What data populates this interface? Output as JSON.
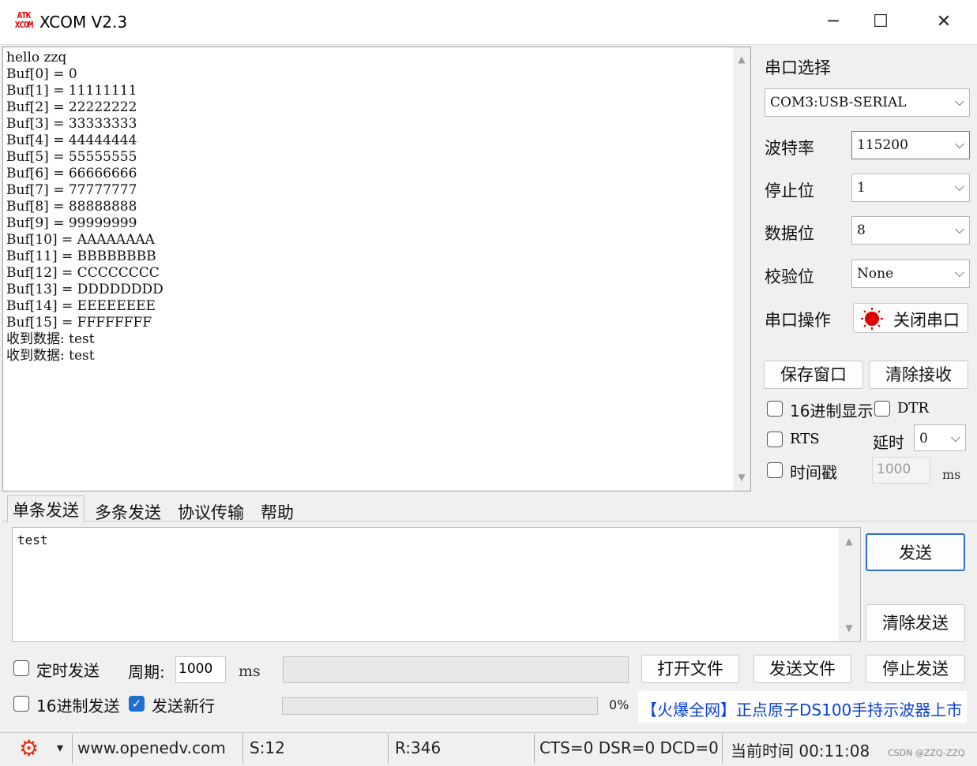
{
  "titlebar": {
    "logo_top": "ATK",
    "logo_bottom": "XCOM",
    "title": "XCOM V2.3",
    "minimize_icon": "─",
    "maximize_icon": "☐",
    "close_icon": "✕"
  },
  "receive": {
    "text": "hello zzq\nBuf[0] = 0\nBuf[1] = 11111111\nBuf[2] = 22222222\nBuf[3] = 33333333\nBuf[4] = 44444444\nBuf[5] = 55555555\nBuf[6] = 66666666\nBuf[7] = 77777777\nBuf[8] = 88888888\nBuf[9] = 99999999\nBuf[10] = AAAAAAAA\nBuf[11] = BBBBBBBB\nBuf[12] = CCCCCCCC\nBuf[13] = DDDDDDDD\nBuf[14] = EEEEEEEE\nBuf[15] = FFFFFFFF\n收到数据: test\n收到数据: test"
  },
  "serial": {
    "port_label": "串口选择",
    "port_value": "COM3:USB-SERIAL",
    "baud_label": "波特率",
    "baud_value": "115200",
    "stop_label": "停止位",
    "stop_value": "1",
    "data_label": "数据位",
    "data_value": "8",
    "parity_label": "校验位",
    "parity_value": "None",
    "op_label": "串口操作",
    "close_port_button": "关闭串口",
    "status_color": "#e00000"
  },
  "actions": {
    "save_window": "保存窗口",
    "clear_receive": "清除接收",
    "hex_display": "16进制显示",
    "dtr": "DTR",
    "rts": "RTS",
    "delay_label": "延时",
    "delay_value": "0",
    "timestamp": "时间戳",
    "timestamp_value": "1000",
    "ms_unit": "ms"
  },
  "tabs": [
    "单条发送",
    "多条发送",
    "协议传输",
    "帮助"
  ],
  "send": {
    "text": "test",
    "send_button": "发送",
    "clear_send_button": "清除发送",
    "timed_send": "定时发送",
    "period_label": "周期:",
    "period_value": "1000",
    "period_unit": "ms",
    "open_file": "打开文件",
    "send_file": "发送文件",
    "stop_send": "停止发送",
    "hex_send": "16进制发送",
    "send_newline": "发送新行",
    "send_newline_checked": true,
    "progress_text": "0%",
    "progress": 0,
    "ad_text": "【火爆全网】正点原子DS100手持示波器上市",
    "ad_color": "#0a3fd8"
  },
  "status": {
    "gear_icon": "⚙",
    "dropdown_icon": "▾",
    "website": "www.openedv.com",
    "sent": "S:12",
    "received": "R:346",
    "signals": "CTS=0 DSR=0 DCD=0",
    "time": "当前时间 00:11:08",
    "watermark": "CSDN @ZZQ-ZZQ"
  }
}
